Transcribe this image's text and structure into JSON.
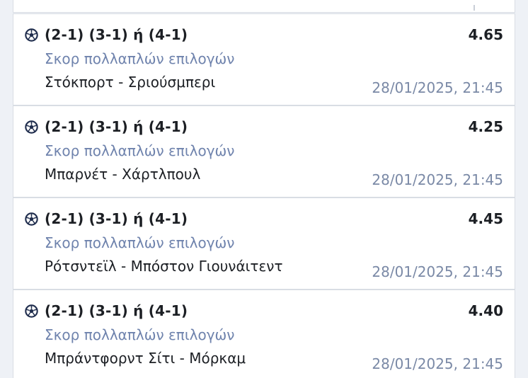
{
  "bets": [
    {
      "icon": "soccer-ball-icon",
      "selection": "(2-1) (3-1) ή (4-1)",
      "odds": "4.65",
      "market": "Σκορ πολλαπλών επιλογών",
      "match": "Στόκπορτ - Σριούσμπερι",
      "datetime": "28/01/2025, 21:45"
    },
    {
      "icon": "soccer-ball-icon",
      "selection": "(2-1) (3-1) ή (4-1)",
      "odds": "4.25",
      "market": "Σκορ πολλαπλών επιλογών",
      "match": "Μπαρνέτ - Χάρτλπουλ",
      "datetime": "28/01/2025, 21:45"
    },
    {
      "icon": "soccer-ball-icon",
      "selection": "(2-1) (3-1) ή (4-1)",
      "odds": "4.45",
      "market": "Σκορ πολλαπλών επιλογών",
      "match": "Ρότσντεϊλ - Μπόστον Γιουνάιτεντ",
      "datetime": "28/01/2025, 21:45"
    },
    {
      "icon": "soccer-ball-icon",
      "selection": "(2-1) (3-1) ή (4-1)",
      "odds": "4.40",
      "market": "Σκορ πολλαπλών επιλογών",
      "match": "Μπράντφορντ Σίτι - Μόρκαμ",
      "datetime": "28/01/2025, 21:45"
    }
  ],
  "colors": {
    "background": "#eef1f6",
    "card": "#ffffff",
    "border": "#d9dde4",
    "primary_text": "#1c1f24",
    "market_text": "#6f83ad",
    "datetime_text": "#7a89a6",
    "icon": "#1f2d4d"
  }
}
